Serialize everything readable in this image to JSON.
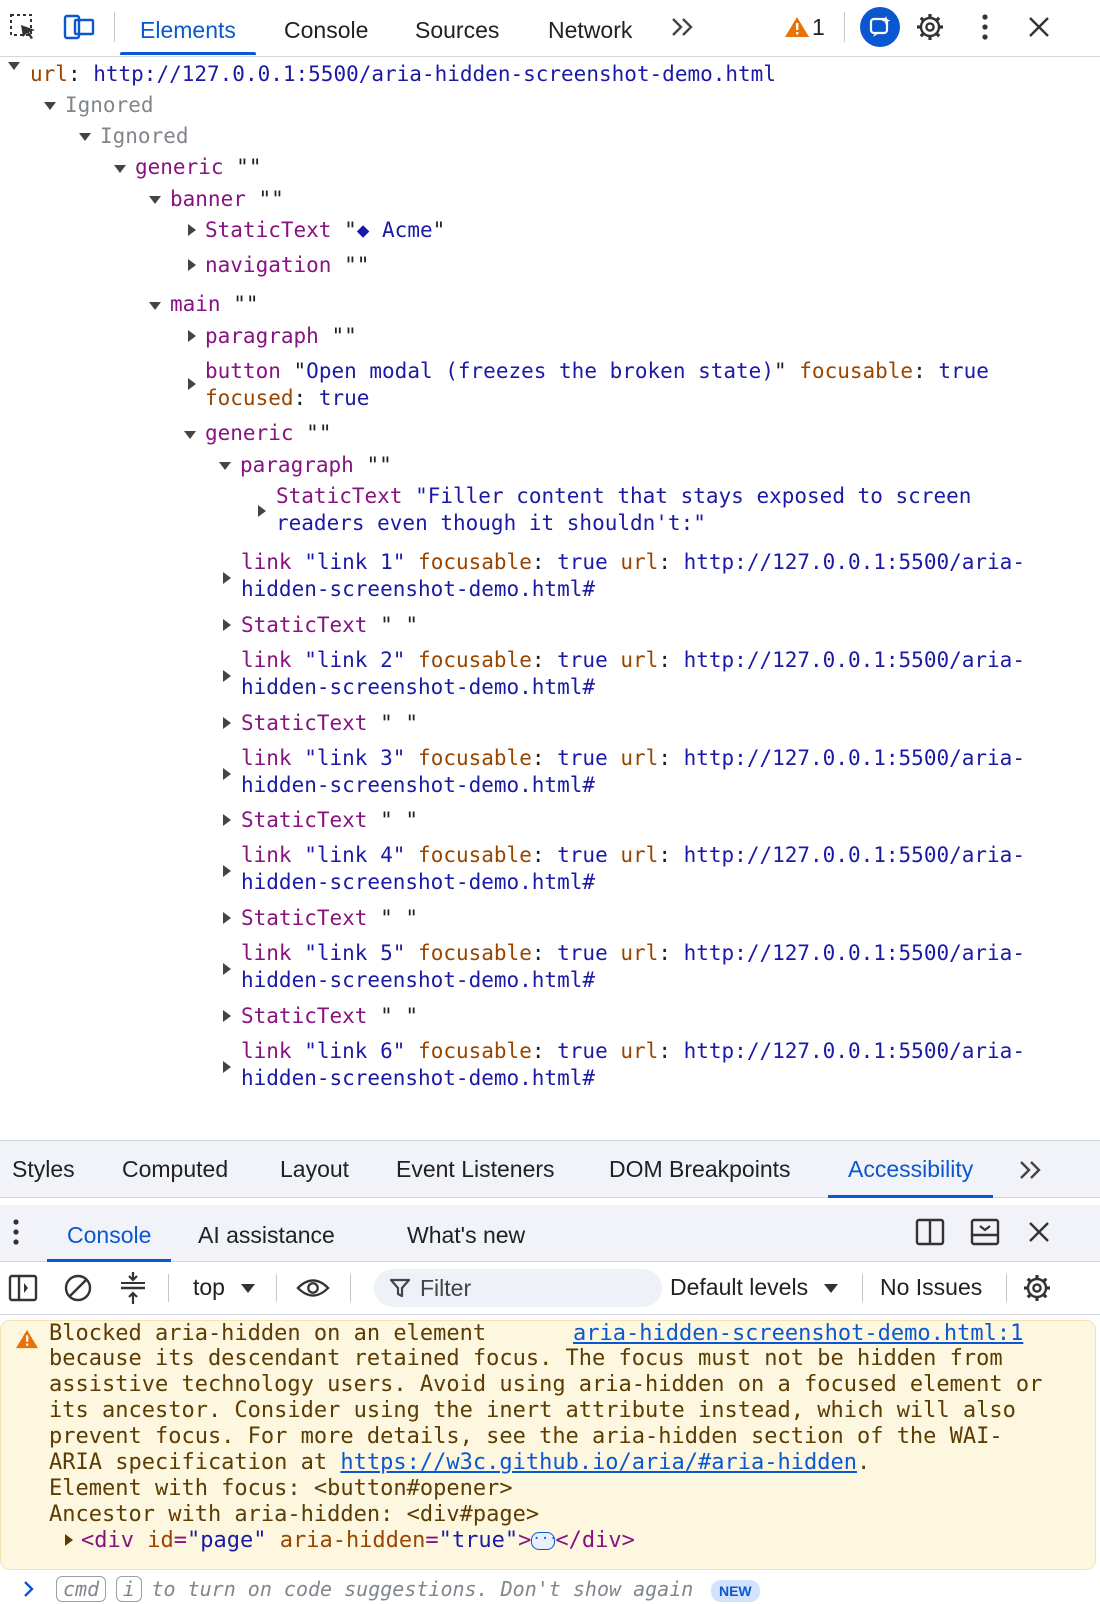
{
  "toolbar": {
    "tabs": [
      {
        "label": "Elements",
        "active": true
      },
      {
        "label": "Console"
      },
      {
        "label": "Sources"
      },
      {
        "label": "Network"
      }
    ],
    "overflow_icon": "double-chevron-right",
    "warning_count": "1",
    "icons": [
      "inspect-element",
      "device-toolbar",
      "warning-triangle",
      "ai-assistant",
      "settings-gear",
      "more-vertical",
      "close"
    ]
  },
  "tree": {
    "url_key": "url",
    "url_value": "http://127.0.0.1:5500/aria-hidden-screenshot-demo.html",
    "ignored": "Ignored",
    "generic": "generic",
    "banner": "banner",
    "statictext": "StaticText",
    "acme_name": "◆ Acme",
    "navigation": "navigation",
    "main": "main",
    "paragraph": "paragraph",
    "button": "button",
    "button_name": "Open modal (freezes the broken state)",
    "focusable_key": "focusable",
    "focused_key": "focused",
    "true_value": "true",
    "empty_quotes": "\"\"",
    "filler_line1": "\"Filler content that stays exposed to screen",
    "filler_line2": "readers even though it shouldn't:\"",
    "link": "link",
    "link_url_line1": "http://127.0.0.1:5500/aria-",
    "link_url_line2": "hidden-screenshot-demo.html#",
    "space_name": "\" \"",
    "links": [
      {
        "name": "\"link 1\""
      },
      {
        "name": "\"link 2\""
      },
      {
        "name": "\"link 3\""
      },
      {
        "name": "\"link 4\""
      },
      {
        "name": "\"link 5\""
      },
      {
        "name": "\"link 6\""
      }
    ]
  },
  "subtabs": {
    "tabs": [
      {
        "label": "Styles"
      },
      {
        "label": "Computed"
      },
      {
        "label": "Layout"
      },
      {
        "label": "Event Listeners"
      },
      {
        "label": "DOM Breakpoints"
      },
      {
        "label": "Accessibility",
        "active": true
      }
    ]
  },
  "drawer": {
    "tabs": [
      {
        "label": "Console",
        "active": true
      },
      {
        "label": "AI assistance"
      },
      {
        "label": "What's new"
      }
    ]
  },
  "console_toolbar": {
    "context": "top",
    "filter_placeholder": "Filter",
    "levels": "Default levels",
    "issues": "No Issues"
  },
  "warning": {
    "line1": "Blocked aria-hidden on an element",
    "source_link": "aria-hidden-screenshot-demo.html:1",
    "line2": "because its descendant retained focus. The focus must not be hidden from",
    "line3": "assistive technology users. Avoid using aria-hidden on a focused element or",
    "line4": "its ancestor. Consider using the inert attribute instead, which will also",
    "line5": "prevent focus. For more details, see the aria-hidden section of the WAI-",
    "line6_prefix": "ARIA specification at ",
    "spec_link": "https://w3c.github.io/aria/#aria-hidden",
    "line6_suffix": ".",
    "line7": "Element with focus: <button#opener>",
    "line8": "Ancestor with aria-hidden: <div#page>",
    "node_tag_open": "<div",
    "node_attr1_name": "id",
    "node_attr1_value": "\"page\"",
    "node_attr2_name": "aria-hidden",
    "node_attr2_value": "\"true\"",
    "node_tag_close": "</div>",
    "colors": {
      "background": "#fef7e0",
      "text": "#5c3c00",
      "icon": "#e8710a"
    }
  },
  "prompt": {
    "kbd1": "cmd",
    "kbd2": "i",
    "text": "to turn on code suggestions. Don't show again",
    "badge": "NEW"
  },
  "colors": {
    "accent": "#0b57d0",
    "role": "#881280",
    "name": "#1a1aa6",
    "property": "#994500"
  }
}
